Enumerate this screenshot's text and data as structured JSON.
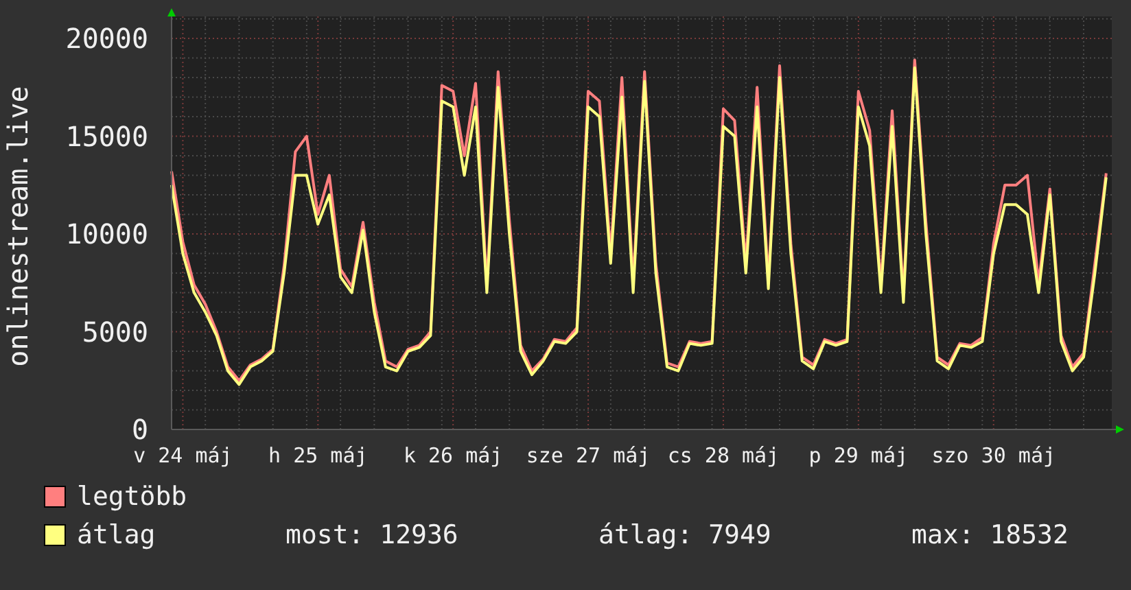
{
  "chart": {
    "chart_data": {
      "type": "line",
      "ylabel": "onlinestream.live",
      "categories": [
        null,
        "v 24 máj",
        null,
        null,
        null,
        null,
        null,
        null,
        null,
        null,
        null,
        null,
        null,
        "h 25 máj",
        null,
        null,
        null,
        null,
        null,
        null,
        null,
        null,
        null,
        null,
        null,
        "k 26 máj",
        null,
        null,
        null,
        null,
        null,
        null,
        null,
        null,
        null,
        null,
        null,
        "sze 27 máj",
        null,
        null,
        null,
        null,
        null,
        null,
        null,
        null,
        null,
        null,
        null,
        "cs 28 máj",
        null,
        null,
        null,
        null,
        null,
        null,
        null,
        null,
        null,
        null,
        null,
        "p 29 máj",
        null,
        null,
        null,
        null,
        null,
        null,
        null,
        null,
        null,
        null,
        null,
        "szo 30 máj",
        null,
        null,
        null,
        null,
        null,
        null,
        null,
        null,
        null,
        null
      ],
      "series": [
        {
          "name": "legtöbb",
          "color": "#ff7f7f",
          "values": [
            13200,
            9600,
            7400,
            6400,
            5000,
            3200,
            2500,
            3300,
            3600,
            4100,
            8400,
            14200,
            15000,
            11000,
            13000,
            8200,
            7300,
            10600,
            6500,
            3500,
            3200,
            4100,
            4300,
            5000,
            17600,
            17300,
            14000,
            17700,
            7400,
            18300,
            10700,
            4300,
            3000,
            3600,
            4600,
            4500,
            5200,
            17300,
            16800,
            9000,
            18000,
            7500,
            18300,
            8500,
            3400,
            3200,
            4500,
            4400,
            4500,
            16400,
            15800,
            8500,
            17500,
            7600,
            18600,
            9500,
            3700,
            3300,
            4600,
            4400,
            4600,
            17300,
            15300,
            7400,
            16300,
            6900,
            18900,
            10600,
            3700,
            3300,
            4400,
            4300,
            4700,
            9500,
            12500,
            12500,
            13000,
            7500,
            12300,
            4800,
            3200,
            3900,
            8500,
            13100
          ]
        },
        {
          "name": "átlag",
          "color": "#ffff80",
          "values": [
            12500,
            9000,
            7000,
            6000,
            4800,
            3000,
            2300,
            3200,
            3500,
            4000,
            8000,
            13000,
            13000,
            10500,
            12000,
            7800,
            7000,
            10200,
            6000,
            3200,
            3000,
            4000,
            4200,
            4800,
            16800,
            16500,
            13000,
            16500,
            7000,
            17500,
            10000,
            4000,
            2800,
            3500,
            4500,
            4400,
            5000,
            16500,
            16000,
            8500,
            17000,
            7000,
            17800,
            8000,
            3200,
            3000,
            4400,
            4300,
            4400,
            15500,
            15000,
            8000,
            16500,
            7200,
            18000,
            9000,
            3500,
            3100,
            4500,
            4300,
            4500,
            16500,
            14500,
            7000,
            15500,
            6500,
            18500,
            10000,
            3500,
            3100,
            4300,
            4200,
            4500,
            9000,
            11500,
            11500,
            11000,
            7000,
            12000,
            4500,
            3000,
            3700,
            8000,
            12900
          ]
        }
      ],
      "ylim": [
        0,
        21000
      ],
      "grid": true,
      "yticks": [
        0,
        5000,
        10000,
        15000,
        20000
      ]
    }
  },
  "stats": [
    "most: 12936",
    "átlag: 7949",
    "max: 18532"
  ]
}
